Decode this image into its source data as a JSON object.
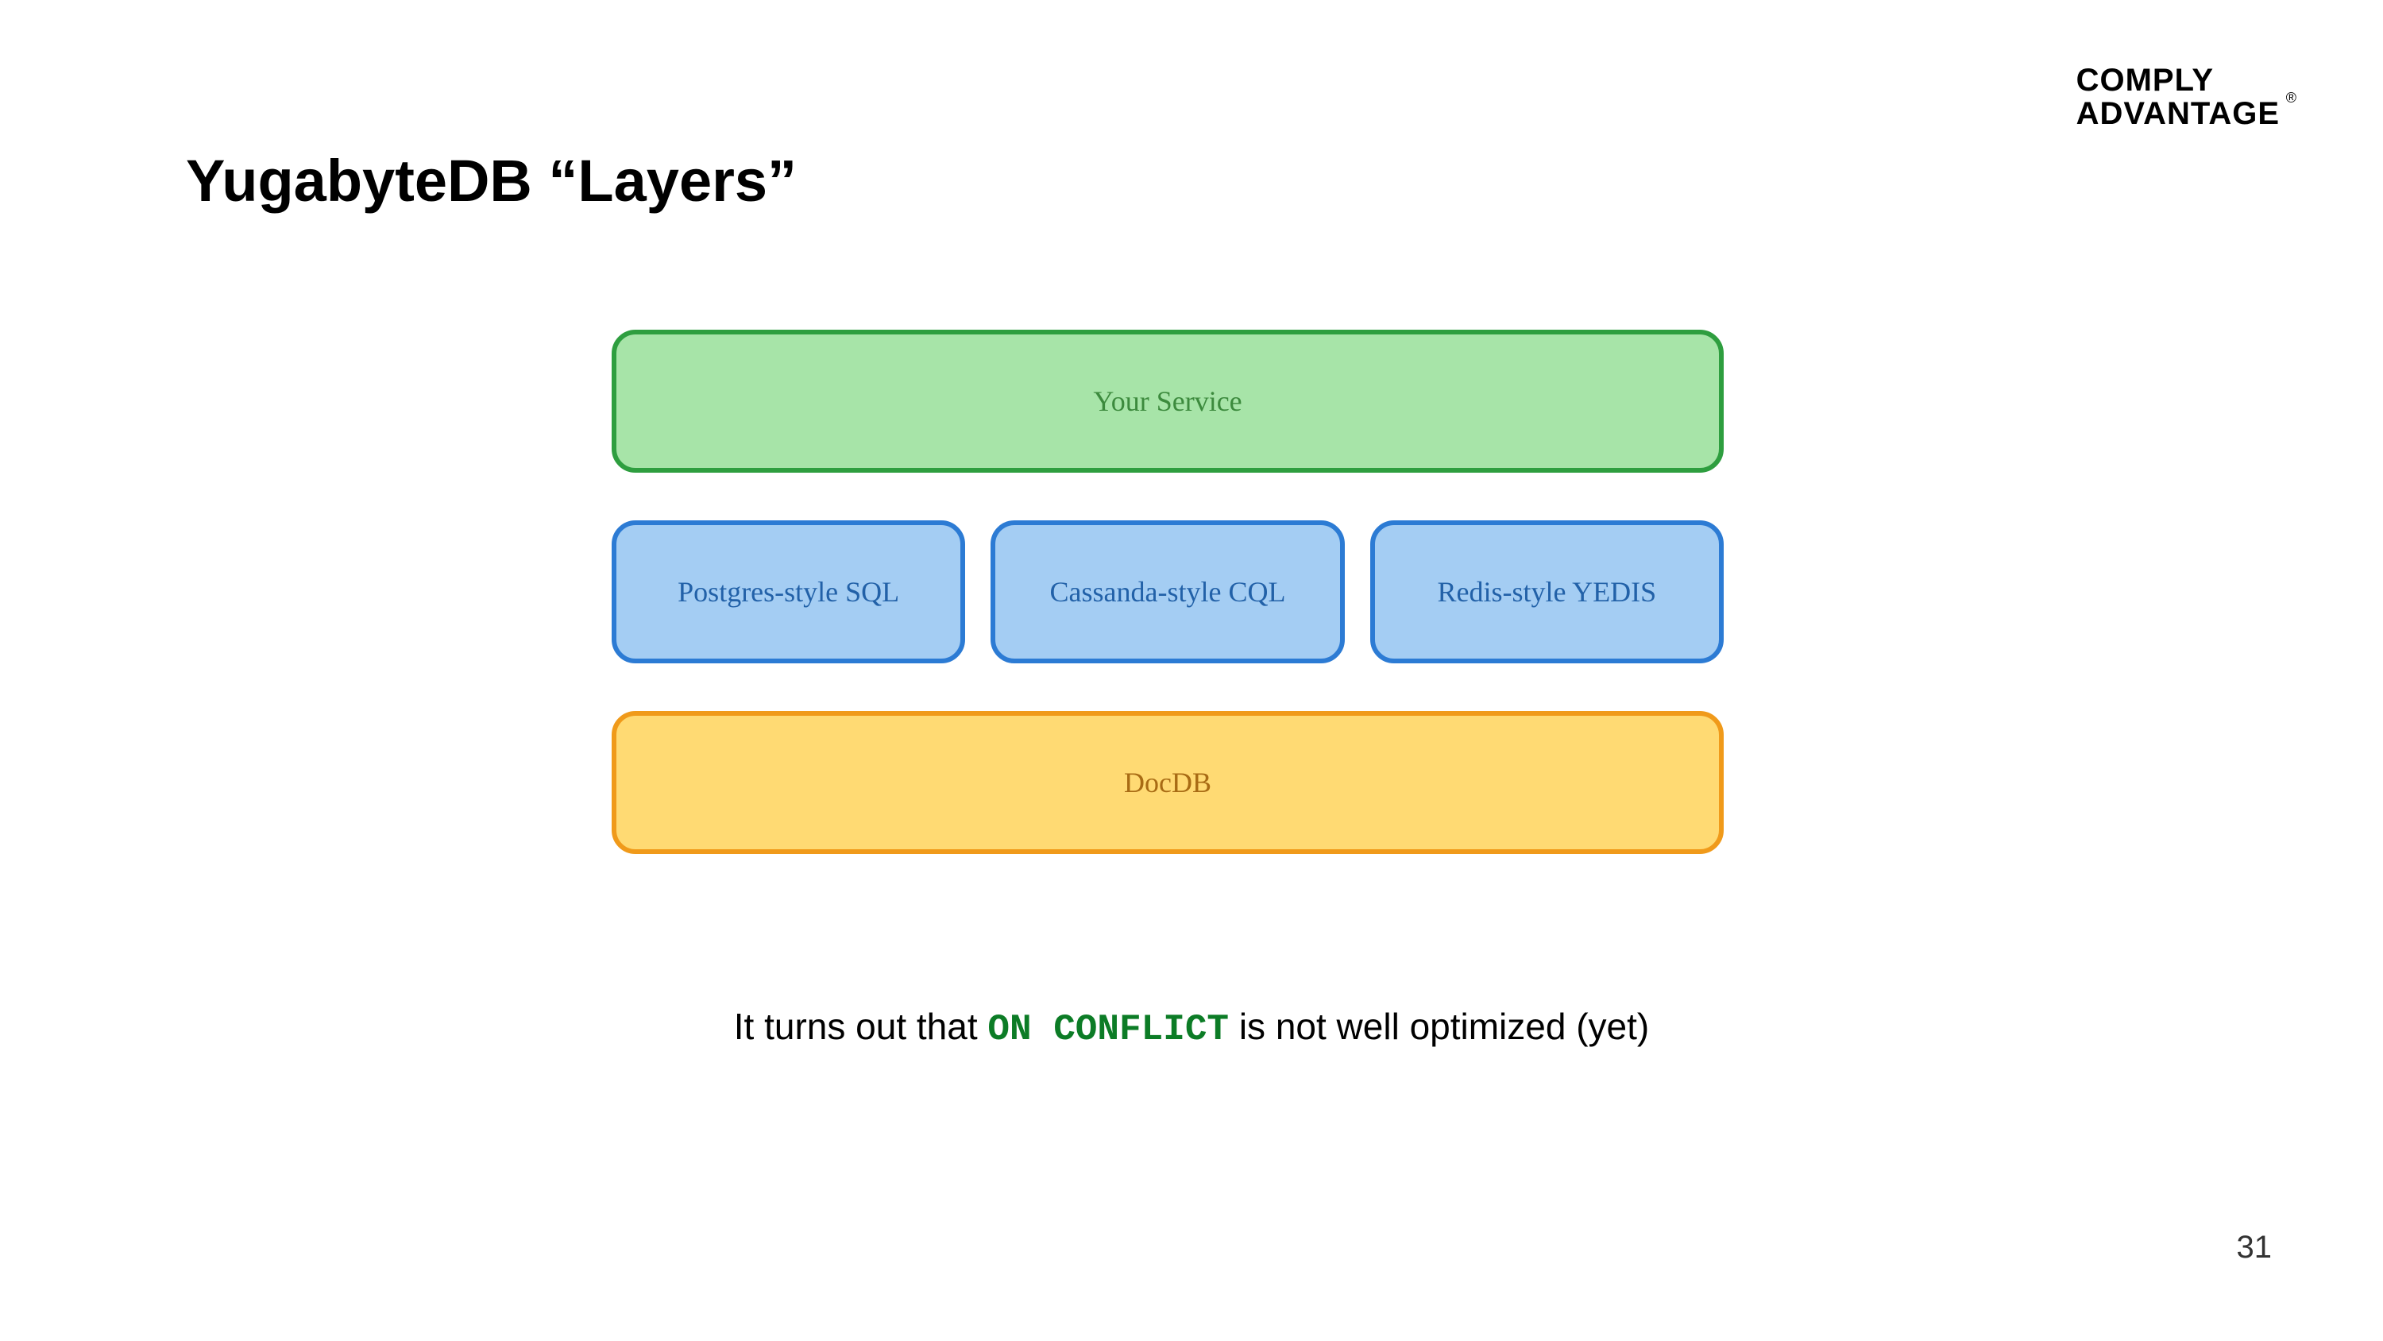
{
  "brand": {
    "line1": "COMPLY",
    "line2": "ADVANTAGE",
    "registered": "®"
  },
  "title": "YugabyteDB “Layers”",
  "layers": {
    "top": "Your Service",
    "middle": [
      "Postgres-style SQL",
      "Cassanda-style CQL",
      "Redis-style YEDIS"
    ],
    "bottom": "DocDB"
  },
  "caption": {
    "prefix": "It turns out that ",
    "code": "ON CONFLICT",
    "suffix": " is not well optimized (yet)"
  },
  "page_number": "31"
}
